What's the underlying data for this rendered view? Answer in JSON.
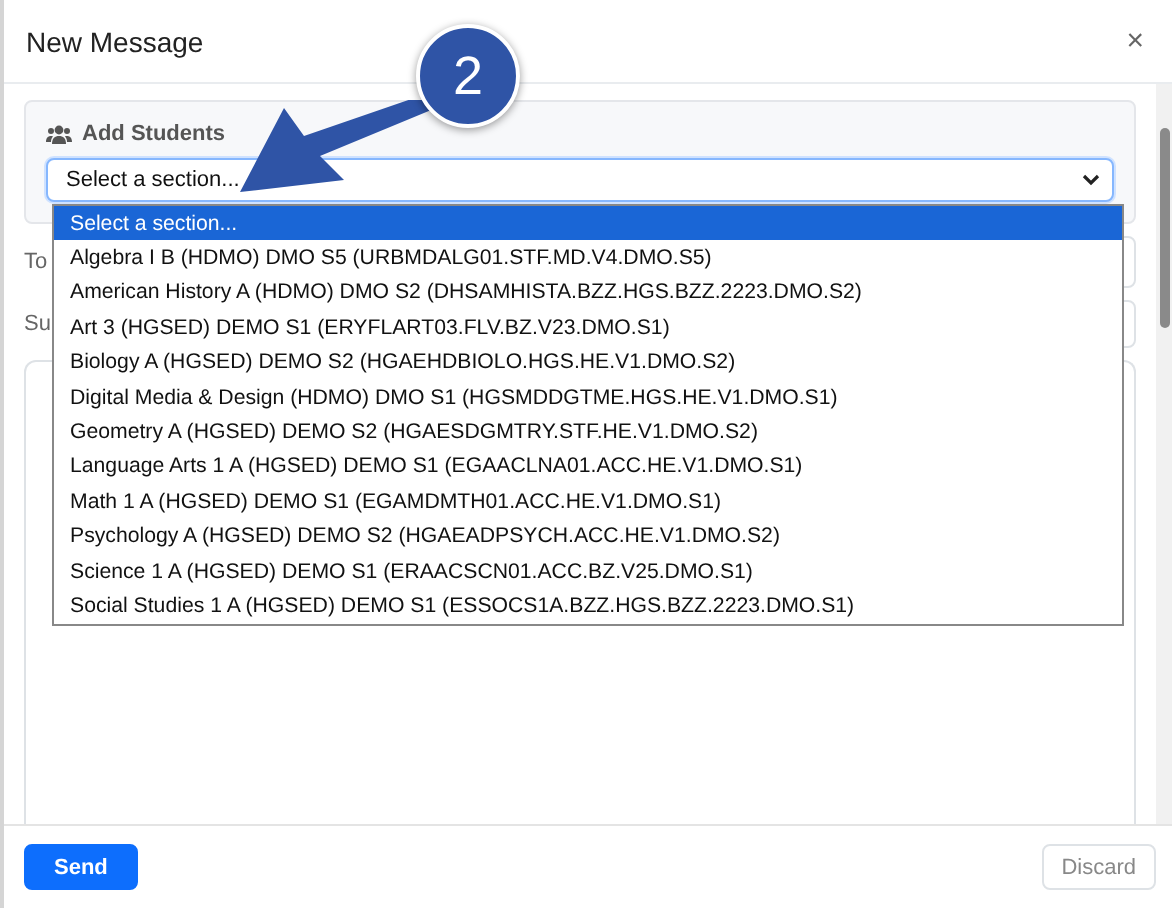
{
  "dialog": {
    "title": "New Message",
    "close": "×"
  },
  "add_students": {
    "label": "Add Students",
    "select": {
      "value": "Select a section..."
    }
  },
  "fields": [
    {
      "label": "To"
    },
    {
      "label": "Su"
    }
  ],
  "dropdown": {
    "options": [
      {
        "label": "Select a section...",
        "selected": true
      },
      {
        "label": "Algebra I B (HDMO) DMO S5 (URBMDALG01.STF.MD.V4.DMO.S5)",
        "selected": false
      },
      {
        "label": "American History A (HDMO) DMO S2 (DHSAMHISTA.BZZ.HGS.BZZ.2223.DMO.S2)",
        "selected": false
      },
      {
        "label": "Art 3 (HGSED) DEMO S1 (ERYFLART03.FLV.BZ.V23.DMO.S1)",
        "selected": false
      },
      {
        "label": "Biology A (HGSED) DEMO S2 (HGAEHDBIOLO.HGS.HE.V1.DMO.S2)",
        "selected": false
      },
      {
        "label": "Digital Media & Design (HDMO) DMO S1 (HGSMDDGTME.HGS.HE.V1.DMO.S1)",
        "selected": false
      },
      {
        "label": "Geometry A (HGSED) DEMO S2 (HGAESDGMTRY.STF.HE.V1.DMO.S2)",
        "selected": false
      },
      {
        "label": "Language Arts 1 A (HGSED) DEMO S1 (EGAACLNA01.ACC.HE.V1.DMO.S1)",
        "selected": false
      },
      {
        "label": "Math 1 A (HGSED) DEMO S1 (EGAMDMTH01.ACC.HE.V1.DMO.S1)",
        "selected": false
      },
      {
        "label": "Psychology A (HGSED) DEMO S2 (HGAEADPSYCH.ACC.HE.V1.DMO.S2)",
        "selected": false
      },
      {
        "label": "Science 1 A (HGSED) DEMO S1 (ERAACSCN01.ACC.BZ.V25.DMO.S1)",
        "selected": false
      },
      {
        "label": "Social Studies 1 A (HGSED) DEMO S1 (ESSOCS1A.BZZ.HGS.BZZ.2223.DMO.S1)",
        "selected": false
      }
    ]
  },
  "annotation": {
    "label": "2"
  },
  "footer": {
    "buttons": [
      {
        "label": "Send",
        "kind": "primary",
        "disabled": false
      },
      {
        "label": "Discard",
        "kind": "secondary",
        "disabled": true
      }
    ]
  }
}
